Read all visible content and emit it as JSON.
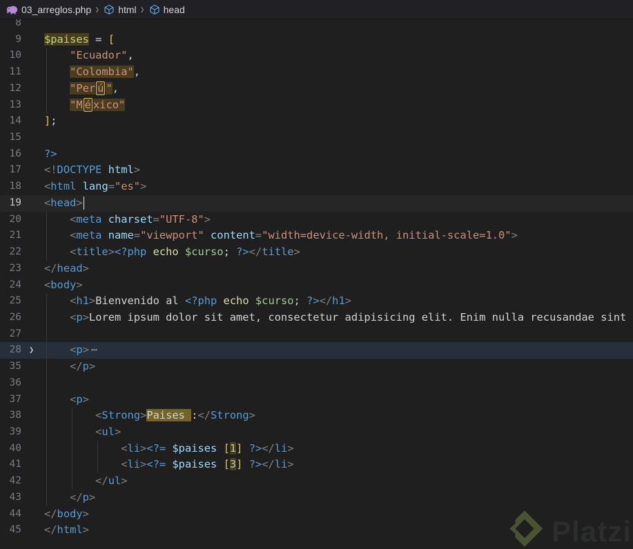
{
  "breadcrumb": {
    "file": "03_arreglos.php",
    "seg_html": "html",
    "seg_head": "head",
    "php_icon_color": "#b48cd4",
    "symbol_icon_color": "#5ba3dc"
  },
  "watermark": {
    "text": "Platzi",
    "logo_color": "#4a5330"
  },
  "colors": {
    "background": "#1f1f1f",
    "tag": "#569cd6",
    "attribute": "#9cdcfe",
    "string": "#ce9178",
    "bracket": "#e8c34e",
    "keyword": "#dcdcaa",
    "variable_green": "#a3cd92",
    "variable_blue": "#9cdcfe",
    "highlight": "rgba(222,160,30,0.23)",
    "highlight_strong": "rgba(255,213,52,0.38)",
    "folded_line": "rgba(70,130,200,0.18)"
  },
  "editor": {
    "fold_chevron": "❯",
    "lines": [
      {
        "n": 8,
        "g": [],
        "t": []
      },
      {
        "n": 9,
        "g": [],
        "t": [
          {
            "s": "$paises",
            "c": "v9",
            "h": 1
          },
          {
            "s": " = ",
            "c": "pl"
          },
          {
            "s": "[",
            "c": "br"
          }
        ]
      },
      {
        "n": 10,
        "g": [
          0
        ],
        "t": [
          {
            "s": "    ",
            "c": "pl"
          },
          {
            "s": "\"Ecuador\"",
            "c": "st"
          },
          {
            "s": ",",
            "c": "pl"
          }
        ]
      },
      {
        "n": 11,
        "g": [
          0
        ],
        "t": [
          {
            "s": "    ",
            "c": "pl"
          },
          {
            "s": "\"Colombia\"",
            "c": "st",
            "h": 1
          },
          {
            "s": ",",
            "c": "pl"
          }
        ]
      },
      {
        "n": 12,
        "g": [
          0
        ],
        "t": [
          {
            "s": "    ",
            "c": "pl"
          },
          {
            "s": "\"Per",
            "c": "st",
            "h": 1
          },
          {
            "s": "ú",
            "c": "st",
            "h": 1,
            "b": 1
          },
          {
            "s": "\"",
            "c": "st",
            "h": 1
          },
          {
            "s": ",",
            "c": "pl"
          }
        ]
      },
      {
        "n": 13,
        "g": [
          0
        ],
        "t": [
          {
            "s": "    ",
            "c": "pl"
          },
          {
            "s": "\"M",
            "c": "st",
            "h": 1
          },
          {
            "s": "é",
            "c": "st",
            "h": 1,
            "b": 1
          },
          {
            "s": "xico\"",
            "c": "st",
            "h": 1
          }
        ]
      },
      {
        "n": 14,
        "g": [],
        "t": [
          {
            "s": "]",
            "c": "br"
          },
          {
            "s": ";",
            "c": "pl"
          }
        ]
      },
      {
        "n": 15,
        "g": [],
        "t": []
      },
      {
        "n": 16,
        "g": [],
        "t": [
          {
            "s": "?>",
            "c": "ph"
          }
        ]
      },
      {
        "n": 17,
        "g": [],
        "t": [
          {
            "s": "<!",
            "c": "pu"
          },
          {
            "s": "DOCTYPE",
            "c": "tg"
          },
          {
            "s": " ",
            "c": "pl"
          },
          {
            "s": "html",
            "c": "at"
          },
          {
            "s": ">",
            "c": "pu"
          }
        ]
      },
      {
        "n": 18,
        "g": [],
        "t": [
          {
            "s": "<",
            "c": "pu"
          },
          {
            "s": "html",
            "c": "tg"
          },
          {
            "s": " ",
            "c": "pl"
          },
          {
            "s": "lang",
            "c": "at"
          },
          {
            "s": "=",
            "c": "pu"
          },
          {
            "s": "\"es\"",
            "c": "st"
          },
          {
            "s": ">",
            "c": "pu"
          }
        ]
      },
      {
        "n": 19,
        "g": [],
        "active": true,
        "t": [
          {
            "s": "<",
            "c": "pu"
          },
          {
            "s": "head",
            "c": "tg"
          },
          {
            "s": ">",
            "c": "pu"
          },
          {
            "cur": 1
          }
        ]
      },
      {
        "n": 20,
        "g": [
          0
        ],
        "t": [
          {
            "s": "    ",
            "c": "pl"
          },
          {
            "s": "<",
            "c": "pu"
          },
          {
            "s": "meta",
            "c": "tg"
          },
          {
            "s": " ",
            "c": "pl"
          },
          {
            "s": "charset",
            "c": "at"
          },
          {
            "s": "=",
            "c": "pu"
          },
          {
            "s": "\"UTF-8\"",
            "c": "st"
          },
          {
            "s": ">",
            "c": "pu"
          }
        ]
      },
      {
        "n": 21,
        "g": [
          0
        ],
        "t": [
          {
            "s": "    ",
            "c": "pl"
          },
          {
            "s": "<",
            "c": "pu"
          },
          {
            "s": "meta",
            "c": "tg"
          },
          {
            "s": " ",
            "c": "pl"
          },
          {
            "s": "name",
            "c": "at"
          },
          {
            "s": "=",
            "c": "pu"
          },
          {
            "s": "\"viewport\"",
            "c": "st"
          },
          {
            "s": " ",
            "c": "pl"
          },
          {
            "s": "content",
            "c": "at"
          },
          {
            "s": "=",
            "c": "pu"
          },
          {
            "s": "\"width=device-width, initial-scale=1.0\"",
            "c": "st"
          },
          {
            "s": ">",
            "c": "pu"
          }
        ]
      },
      {
        "n": 22,
        "g": [
          0
        ],
        "t": [
          {
            "s": "    ",
            "c": "pl"
          },
          {
            "s": "<",
            "c": "pu"
          },
          {
            "s": "title",
            "c": "tg"
          },
          {
            "s": ">",
            "c": "pu"
          },
          {
            "s": "<?php",
            "c": "ph"
          },
          {
            "s": " ",
            "c": "pl"
          },
          {
            "s": "echo",
            "c": "kw"
          },
          {
            "s": " ",
            "c": "pl"
          },
          {
            "s": "$curso",
            "c": "vg"
          },
          {
            "s": ";",
            "c": "pl"
          },
          {
            "s": " ",
            "c": "pl"
          },
          {
            "s": "?>",
            "c": "ph"
          },
          {
            "s": "</",
            "c": "pu"
          },
          {
            "s": "title",
            "c": "tg"
          },
          {
            "s": ">",
            "c": "pu"
          }
        ]
      },
      {
        "n": 23,
        "g": [],
        "t": [
          {
            "s": "</",
            "c": "pu"
          },
          {
            "s": "head",
            "c": "tg"
          },
          {
            "s": ">",
            "c": "pu"
          }
        ]
      },
      {
        "n": 24,
        "g": [],
        "t": [
          {
            "s": "<",
            "c": "pu"
          },
          {
            "s": "body",
            "c": "tg"
          },
          {
            "s": ">",
            "c": "pu"
          }
        ]
      },
      {
        "n": 25,
        "g": [
          0
        ],
        "t": [
          {
            "s": "    ",
            "c": "pl"
          },
          {
            "s": "<",
            "c": "pu"
          },
          {
            "s": "h1",
            "c": "tg"
          },
          {
            "s": ">",
            "c": "pu"
          },
          {
            "s": "Bienvenido al ",
            "c": "pl"
          },
          {
            "s": "<?php",
            "c": "ph"
          },
          {
            "s": " ",
            "c": "pl"
          },
          {
            "s": "echo",
            "c": "kw"
          },
          {
            "s": " ",
            "c": "pl"
          },
          {
            "s": "$curso",
            "c": "vg"
          },
          {
            "s": ";",
            "c": "pl"
          },
          {
            "s": " ",
            "c": "pl"
          },
          {
            "s": "?>",
            "c": "ph"
          },
          {
            "s": "</",
            "c": "pu"
          },
          {
            "s": "h1",
            "c": "tg"
          },
          {
            "s": ">",
            "c": "pu"
          }
        ]
      },
      {
        "n": 26,
        "g": [
          0
        ],
        "t": [
          {
            "s": "    ",
            "c": "pl"
          },
          {
            "s": "<",
            "c": "pu"
          },
          {
            "s": "p",
            "c": "tg"
          },
          {
            "s": ">",
            "c": "pu"
          },
          {
            "s": "Lorem ipsum dolor sit amet, consectetur adipisicing elit. Enim nulla recusandae sint",
            "c": "pl"
          }
        ]
      },
      {
        "n": 27,
        "g": [
          0
        ],
        "t": []
      },
      {
        "n": 28,
        "g": [
          0
        ],
        "fold": true,
        "foldedbg": true,
        "t": [
          {
            "s": "    ",
            "c": "pl"
          },
          {
            "s": "<",
            "c": "pu"
          },
          {
            "s": "p",
            "c": "tg"
          },
          {
            "s": ">",
            "c": "pu"
          },
          {
            "s": "⋯",
            "c": "el"
          }
        ]
      },
      {
        "n": 35,
        "g": [
          0
        ],
        "t": [
          {
            "s": "    ",
            "c": "pl"
          },
          {
            "s": "</",
            "c": "pu"
          },
          {
            "s": "p",
            "c": "tg"
          },
          {
            "s": ">",
            "c": "pu"
          }
        ]
      },
      {
        "n": 36,
        "g": [
          0
        ],
        "t": []
      },
      {
        "n": 37,
        "g": [
          0
        ],
        "t": [
          {
            "s": "    ",
            "c": "pl"
          },
          {
            "s": "<",
            "c": "pu"
          },
          {
            "s": "p",
            "c": "tg"
          },
          {
            "s": ">",
            "c": "pu"
          }
        ]
      },
      {
        "n": 38,
        "g": [
          0,
          1
        ],
        "t": [
          {
            "s": "        ",
            "c": "pl"
          },
          {
            "s": "<",
            "c": "pu"
          },
          {
            "s": "Strong",
            "c": "tg"
          },
          {
            "s": ">",
            "c": "pu"
          },
          {
            "s": "Paises ",
            "c": "pl",
            "h": 2
          },
          {
            "s": ":",
            "c": "pl"
          },
          {
            "s": "</",
            "c": "pu"
          },
          {
            "s": "Strong",
            "c": "tg"
          },
          {
            "s": ">",
            "c": "pu"
          }
        ]
      },
      {
        "n": 39,
        "g": [
          0,
          1
        ],
        "t": [
          {
            "s": "        ",
            "c": "pl"
          },
          {
            "s": "<",
            "c": "pu"
          },
          {
            "s": "ul",
            "c": "tg"
          },
          {
            "s": ">",
            "c": "pu"
          }
        ]
      },
      {
        "n": 40,
        "g": [
          0,
          1,
          2
        ],
        "t": [
          {
            "s": "            ",
            "c": "pl"
          },
          {
            "s": "<",
            "c": "pu"
          },
          {
            "s": "li",
            "c": "tg"
          },
          {
            "s": ">",
            "c": "pu"
          },
          {
            "s": "<?=",
            "c": "ph"
          },
          {
            "s": " ",
            "c": "pl"
          },
          {
            "s": "$paises",
            "c": "vb"
          },
          {
            "s": " ",
            "c": "pl"
          },
          {
            "s": "[",
            "c": "br"
          },
          {
            "s": "1",
            "c": "nu",
            "h": 1
          },
          {
            "s": "]",
            "c": "br"
          },
          {
            "s": " ",
            "c": "pl"
          },
          {
            "s": "?>",
            "c": "ph"
          },
          {
            "s": "</",
            "c": "pu"
          },
          {
            "s": "li",
            "c": "tg"
          },
          {
            "s": ">",
            "c": "pu"
          }
        ]
      },
      {
        "n": 41,
        "g": [
          0,
          1,
          2
        ],
        "t": [
          {
            "s": "            ",
            "c": "pl"
          },
          {
            "s": "<",
            "c": "pu"
          },
          {
            "s": "li",
            "c": "tg"
          },
          {
            "s": ">",
            "c": "pu"
          },
          {
            "s": "<?=",
            "c": "ph"
          },
          {
            "s": " ",
            "c": "pl"
          },
          {
            "s": "$paises",
            "c": "vb"
          },
          {
            "s": " ",
            "c": "pl"
          },
          {
            "s": "[",
            "c": "br"
          },
          {
            "s": "3",
            "c": "nu",
            "h": 1
          },
          {
            "s": "]",
            "c": "br"
          },
          {
            "s": " ",
            "c": "pl"
          },
          {
            "s": "?>",
            "c": "ph"
          },
          {
            "s": "</",
            "c": "pu"
          },
          {
            "s": "li",
            "c": "tg"
          },
          {
            "s": ">",
            "c": "pu"
          }
        ]
      },
      {
        "n": 42,
        "g": [
          0,
          1
        ],
        "t": [
          {
            "s": "        ",
            "c": "pl"
          },
          {
            "s": "</",
            "c": "pu"
          },
          {
            "s": "ul",
            "c": "tg"
          },
          {
            "s": ">",
            "c": "pu"
          }
        ]
      },
      {
        "n": 43,
        "g": [
          0
        ],
        "t": [
          {
            "s": "    ",
            "c": "pl"
          },
          {
            "s": "</",
            "c": "pu"
          },
          {
            "s": "p",
            "c": "tg"
          },
          {
            "s": ">",
            "c": "pu"
          }
        ]
      },
      {
        "n": 44,
        "g": [],
        "t": [
          {
            "s": "</",
            "c": "pu"
          },
          {
            "s": "body",
            "c": "tg"
          },
          {
            "s": ">",
            "c": "pu"
          }
        ]
      },
      {
        "n": 45,
        "g": [],
        "t": [
          {
            "s": "</",
            "c": "pu"
          },
          {
            "s": "html",
            "c": "tg"
          },
          {
            "s": ">",
            "c": "pu"
          }
        ]
      }
    ]
  }
}
